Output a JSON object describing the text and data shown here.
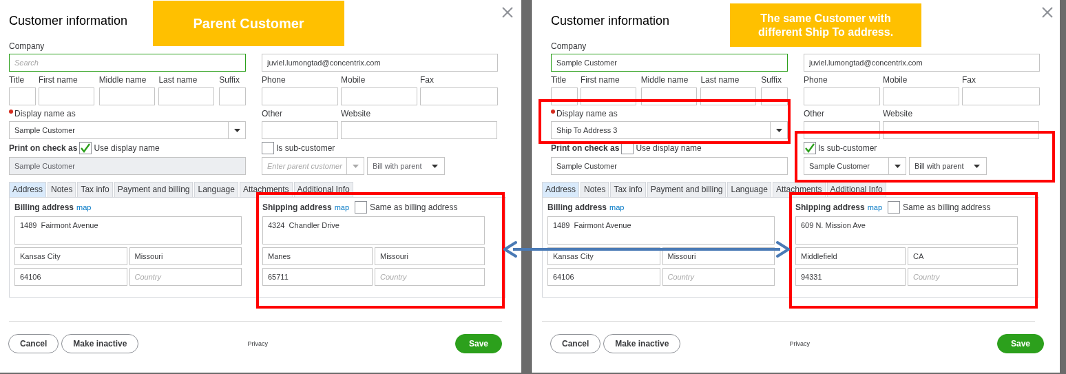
{
  "dialogs": [
    {
      "title": "Customer information",
      "banner": [
        "Parent Customer"
      ],
      "company": {
        "label": "Company",
        "placeholder": "Search"
      },
      "email": {
        "value": "juviel.lumongtad@concentrix.com"
      },
      "name_fields": [
        {
          "label": "Title"
        },
        {
          "label": "First name"
        },
        {
          "label": "Middle name"
        },
        {
          "label": "Last name"
        },
        {
          "label": "Suffix"
        }
      ],
      "contact_fields": [
        {
          "label": "Phone"
        },
        {
          "label": "Mobile"
        },
        {
          "label": "Fax"
        }
      ],
      "display_name": {
        "label": "Display name as",
        "value": "Sample Customer"
      },
      "other_fields": [
        {
          "label": "Other"
        },
        {
          "label": "Website"
        }
      ],
      "print_on_check": {
        "label": "Print on check as",
        "checkbox_label": "Use display name",
        "checked": true,
        "value": "Sample Customer"
      },
      "sub_customer": {
        "label": "Is sub-customer",
        "checked": false,
        "parent_placeholder": "Enter parent customer",
        "bill_with": "Bill with parent"
      },
      "tabs": [
        {
          "label": "Address",
          "selected": true
        },
        {
          "label": "Notes",
          "selected": false
        },
        {
          "label": "Tax info",
          "selected": false
        },
        {
          "label": "Payment and billing",
          "selected": false
        },
        {
          "label": "Language",
          "selected": false
        },
        {
          "label": "Attachments",
          "selected": false
        },
        {
          "label": "Additional Info",
          "selected": false
        }
      ],
      "billing": {
        "label": "Billing address",
        "map": "map",
        "street": "1489  Fairmont Avenue",
        "city": "Kansas City",
        "state": "Missouri",
        "zip": "64106",
        "country_placeholder": "Country"
      },
      "shipping": {
        "label": "Shipping address",
        "map": "map",
        "same_label": "Same as billing address",
        "same_checked": false,
        "street": "4324  Chandler Drive",
        "city": "Manes",
        "state": "Missouri",
        "zip": "65711",
        "country_placeholder": "Country",
        "highlighted": true
      },
      "buttons": {
        "cancel": "Cancel",
        "inactive": "Make inactive",
        "privacy": "Privacy",
        "save": "Save"
      }
    },
    {
      "title": "Customer information",
      "banner": [
        "The same Customer with",
        "different Ship To address."
      ],
      "company": {
        "label": "Company",
        "value": "Sample Customer"
      },
      "email": {
        "value": "juviel.lumongtad@concentrix.com"
      },
      "name_fields": [
        {
          "label": "Title"
        },
        {
          "label": "First name"
        },
        {
          "label": "Middle name"
        },
        {
          "label": "Last name"
        },
        {
          "label": "Suffix"
        }
      ],
      "contact_fields": [
        {
          "label": "Phone"
        },
        {
          "label": "Mobile"
        },
        {
          "label": "Fax"
        }
      ],
      "display_name": {
        "label": "Display name as",
        "value": "Ship To Address 3",
        "highlighted": true
      },
      "other_fields": [
        {
          "label": "Other"
        },
        {
          "label": "Website"
        }
      ],
      "print_on_check": {
        "label": "Print on check as",
        "checkbox_label": "Use display name",
        "checked": false,
        "value": "Sample Customer"
      },
      "sub_customer": {
        "label": "Is sub-customer",
        "checked": true,
        "parent_value": "Sample Customer",
        "bill_with": "Bill with parent",
        "highlighted": true
      },
      "tabs": [
        {
          "label": "Address",
          "selected": true
        },
        {
          "label": "Notes",
          "selected": false
        },
        {
          "label": "Tax info",
          "selected": false
        },
        {
          "label": "Payment and billing",
          "selected": false
        },
        {
          "label": "Language",
          "selected": false
        },
        {
          "label": "Attachments",
          "selected": false
        },
        {
          "label": "Additional Info",
          "selected": false
        }
      ],
      "billing": {
        "label": "Billing address",
        "map": "map",
        "street": "1489  Fairmont Avenue",
        "city": "Kansas City",
        "state": "Missouri",
        "zip": "64106",
        "country_placeholder": "Country"
      },
      "shipping": {
        "label": "Shipping address",
        "map": "map",
        "same_label": "Same as billing address",
        "same_checked": false,
        "street": "609 N. Mission Ave",
        "city": "Middlefield",
        "state": "CA",
        "zip": "94331",
        "country_placeholder": "Country",
        "highlighted": true
      },
      "buttons": {
        "cancel": "Cancel",
        "inactive": "Make inactive",
        "privacy": "Privacy",
        "save": "Save"
      }
    }
  ]
}
